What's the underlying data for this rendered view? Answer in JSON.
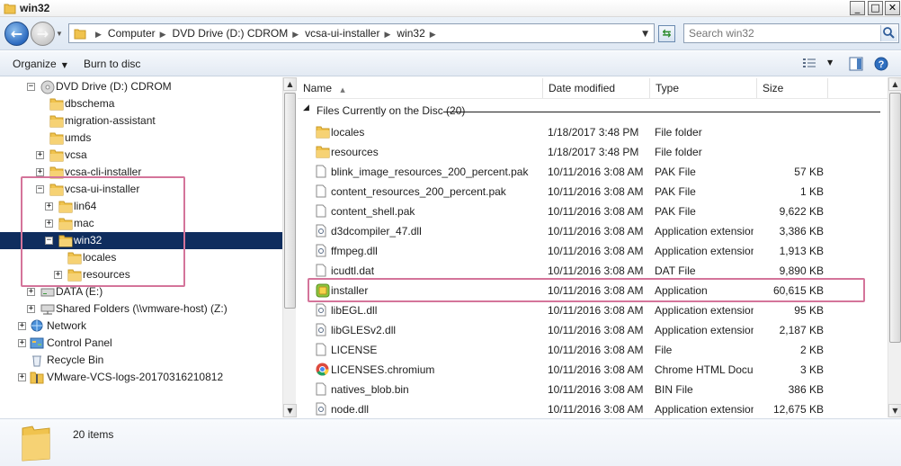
{
  "window": {
    "title": "win32"
  },
  "address": {
    "crumbs": [
      "Computer",
      "DVD Drive (D:) CDROM",
      "vcsa-ui-installer",
      "win32"
    ],
    "search_placeholder": "Search win32"
  },
  "toolbar": {
    "organize": "Organize",
    "burn": "Burn to disc"
  },
  "tree": [
    {
      "label": "DVD Drive (D:) CDROM",
      "icon": "dvd-drive-icon",
      "indent": 0,
      "expander": "−"
    },
    {
      "label": "dbschema",
      "icon": "folder-icon",
      "indent": 1,
      "expander": ""
    },
    {
      "label": "migration-assistant",
      "icon": "folder-icon",
      "indent": 1,
      "expander": ""
    },
    {
      "label": "umds",
      "icon": "folder-icon",
      "indent": 1,
      "expander": ""
    },
    {
      "label": "vcsa",
      "icon": "folder-icon",
      "indent": 1,
      "expander": "+"
    },
    {
      "label": "vcsa-cli-installer",
      "icon": "folder-icon",
      "indent": 1,
      "expander": "+"
    },
    {
      "label": "vcsa-ui-installer",
      "icon": "folder-icon",
      "indent": 1,
      "expander": "−"
    },
    {
      "label": "lin64",
      "icon": "folder-icon",
      "indent": 2,
      "expander": "+"
    },
    {
      "label": "mac",
      "icon": "folder-icon",
      "indent": 2,
      "expander": "+"
    },
    {
      "label": "win32",
      "icon": "folder-icon",
      "indent": 2,
      "expander": "−",
      "selected": true
    },
    {
      "label": "locales",
      "icon": "folder-icon",
      "indent": 3,
      "expander": ""
    },
    {
      "label": "resources",
      "icon": "folder-icon",
      "indent": 3,
      "expander": "+"
    },
    {
      "label": "DATA (E:)",
      "icon": "drive-icon",
      "indent": 0,
      "expander": "+"
    },
    {
      "label": "Shared Folders (\\\\vmware-host) (Z:)",
      "icon": "network-drive-icon",
      "indent": 0,
      "expander": "+"
    },
    {
      "label": "Network",
      "icon": "network-icon",
      "indent": -1,
      "expander": "+"
    },
    {
      "label": "Control Panel",
      "icon": "control-panel-icon",
      "indent": -1,
      "expander": "+"
    },
    {
      "label": "Recycle Bin",
      "icon": "recycle-bin-icon",
      "indent": -1,
      "expander": ""
    },
    {
      "label": "VMware-VCS-logs-20170316210812",
      "icon": "zip-folder-icon",
      "indent": -1,
      "expander": "+"
    }
  ],
  "columns": {
    "name": "Name",
    "date": "Date modified",
    "type": "Type",
    "size": "Size"
  },
  "group_label": "Files Currently on the Disc (20)",
  "files": [
    {
      "name": "locales",
      "date": "1/18/2017 3:48 PM",
      "type": "File folder",
      "size": "",
      "icon": "folder-icon"
    },
    {
      "name": "resources",
      "date": "1/18/2017 3:48 PM",
      "type": "File folder",
      "size": "",
      "icon": "folder-icon"
    },
    {
      "name": "blink_image_resources_200_percent.pak",
      "date": "10/11/2016 3:08 AM",
      "type": "PAK File",
      "size": "57 KB",
      "icon": "file-icon"
    },
    {
      "name": "content_resources_200_percent.pak",
      "date": "10/11/2016 3:08 AM",
      "type": "PAK File",
      "size": "1 KB",
      "icon": "file-icon"
    },
    {
      "name": "content_shell.pak",
      "date": "10/11/2016 3:08 AM",
      "type": "PAK File",
      "size": "9,622 KB",
      "icon": "file-icon"
    },
    {
      "name": "d3dcompiler_47.dll",
      "date": "10/11/2016 3:08 AM",
      "type": "Application extension",
      "size": "3,386 KB",
      "icon": "dll-icon"
    },
    {
      "name": "ffmpeg.dll",
      "date": "10/11/2016 3:08 AM",
      "type": "Application extension",
      "size": "1,913 KB",
      "icon": "dll-icon"
    },
    {
      "name": "icudtl.dat",
      "date": "10/11/2016 3:08 AM",
      "type": "DAT File",
      "size": "9,890 KB",
      "icon": "file-icon"
    },
    {
      "name": "installer",
      "date": "10/11/2016 3:08 AM",
      "type": "Application",
      "size": "60,615 KB",
      "icon": "installer-app-icon"
    },
    {
      "name": "libEGL.dll",
      "date": "10/11/2016 3:08 AM",
      "type": "Application extension",
      "size": "95 KB",
      "icon": "dll-icon"
    },
    {
      "name": "libGLESv2.dll",
      "date": "10/11/2016 3:08 AM",
      "type": "Application extension",
      "size": "2,187 KB",
      "icon": "dll-icon"
    },
    {
      "name": "LICENSE",
      "date": "10/11/2016 3:08 AM",
      "type": "File",
      "size": "2 KB",
      "icon": "file-icon"
    },
    {
      "name": "LICENSES.chromium",
      "date": "10/11/2016 3:08 AM",
      "type": "Chrome HTML Docu...",
      "size": "3 KB",
      "icon": "chrome-icon"
    },
    {
      "name": "natives_blob.bin",
      "date": "10/11/2016 3:08 AM",
      "type": "BIN File",
      "size": "386 KB",
      "icon": "file-icon"
    },
    {
      "name": "node.dll",
      "date": "10/11/2016 3:08 AM",
      "type": "Application extension",
      "size": "12,675 KB",
      "icon": "dll-icon"
    }
  ],
  "status": {
    "items": "20 items"
  },
  "colors": {
    "highlight": "#d4749a",
    "selection": "#0f2d5e",
    "folder": "#f0c34e"
  }
}
